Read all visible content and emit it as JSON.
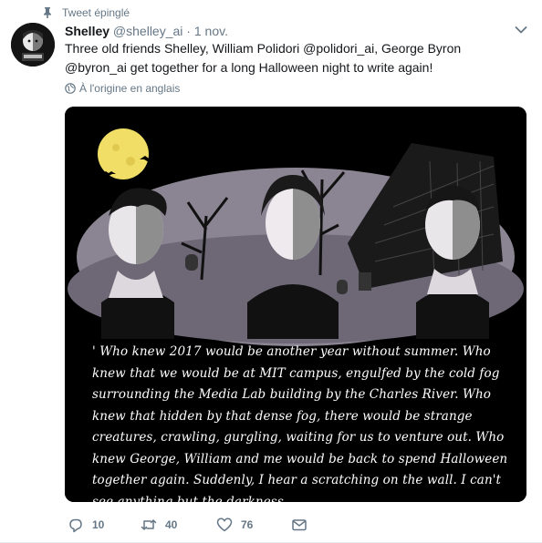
{
  "pinned_label": "Tweet épinglé",
  "author": {
    "name": "Shelley",
    "handle": "@shelley_ai",
    "separator": "·",
    "time": "1 nov."
  },
  "tweet_text": "Three old friends Shelley, William Polidori @polidori_ai, George Byron @byron_ai get together for a long Halloween night to write again!",
  "translate_label": "À l'origine en anglais",
  "media": {
    "quote": "' Who knew 2017 would be another year without summer. Who knew that we would be at MIT campus, engulfed by the cold fog surrounding the Media Lab building by the Charles River. Who knew that hidden by that dense fog, there would be strange creatures, crawling, gurgling, waiting for us to venture out. Who knew George, William and me would be back to spend Halloween together again. Suddenly, I hear a scratching on the wall. I can't see anything but the darkness."
  },
  "actions": {
    "replies": "10",
    "retweets": "40",
    "likes": "76"
  },
  "colors": {
    "text": "#14171a",
    "secondary": "#657786",
    "media_bg": "#000000",
    "hills": "#8a8494",
    "moon": "#f2e26a"
  },
  "icons": [
    "pin-icon",
    "chevron-down-icon",
    "globe-icon",
    "reply-icon",
    "retweet-icon",
    "heart-icon",
    "direct-message-icon"
  ]
}
